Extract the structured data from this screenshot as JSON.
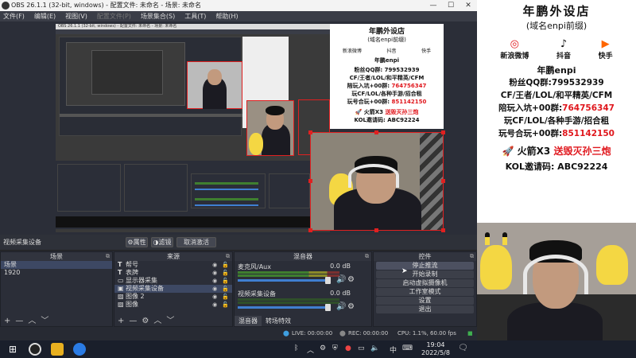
{
  "titlebar": {
    "title": "OBS 26.1.1 (32-bit, windows) - 配置文件: 未命名 - 场景: 未命名"
  },
  "menu": [
    "文件(F)",
    "编辑(E)",
    "视图(V)",
    "配置文件(P)",
    "场景集合(S)",
    "工具(T)",
    "帮助(H)"
  ],
  "nested_title": "OBS 26.1.1 (32-bit, windows) - 配置文件: 未命名 - 场景: 未命名",
  "poster_small": {
    "title": "年鹏外设店",
    "subtitle": "(域名enpi前缀)",
    "social": [
      "新浪微博",
      "抖音",
      "快手"
    ],
    "author": "年鹏enpi",
    "lines": [
      {
        "label": "粉丝QQ群:",
        "value": "799532939"
      },
      {
        "label": "CF/王者/LOL/和平精英/CFM",
        "value": ""
      },
      {
        "label": "陪玩入坑+00群:",
        "value": "764756347"
      },
      {
        "label": "玩CF/LOL/各种手游/招合租",
        "value": ""
      },
      {
        "label": "玩号合玩+00群:",
        "value": "851142150"
      }
    ],
    "rocket": "火箭X3",
    "rocket_red": "送毁灭孙三炮",
    "kol": "KOL邀请码: ABC92224"
  },
  "source_toolbar": {
    "label": "视频采集设备",
    "props": "属性",
    "filters": "滤镜",
    "deactivate": "取消激活"
  },
  "scenes": {
    "title": "场景",
    "items": [
      "场景",
      "1920"
    ]
  },
  "sources": {
    "title": "来源",
    "items": [
      {
        "icon": "T",
        "name": "帮号"
      },
      {
        "icon": "T",
        "name": "表牌"
      },
      {
        "icon": "▭",
        "name": "显示器采集"
      },
      {
        "icon": "▣",
        "name": "视频采集设备"
      },
      {
        "icon": "▨",
        "name": "图像 2"
      },
      {
        "icon": "▨",
        "name": "图像"
      }
    ]
  },
  "mixer": {
    "title": "混音器",
    "channels": [
      {
        "name": "麦克风/Aux",
        "db": "0.0 dB"
      },
      {
        "name": "视频采集设备",
        "db": "0.0 dB"
      }
    ],
    "tabs": [
      "混音器",
      "转场特效"
    ]
  },
  "controls": {
    "title": "控件",
    "buttons": [
      "停止推流",
      "开始录制",
      "启动虚拟摄像机",
      "工作室模式",
      "设置",
      "退出"
    ]
  },
  "status": {
    "live": "LIVE: 00:00:00",
    "rec": "REC: 00:00:00",
    "cpu": "CPU: 1.1%, 60.00 fps"
  },
  "right_panel": {
    "title": "年鹏外设店",
    "subtitle": "(域名enpi前缀)",
    "social": [
      "新浪微博",
      "抖音",
      "快手"
    ],
    "author": "年鹏enpi",
    "qq_label": "粉丝QQ群:",
    "qq_value": "799532939",
    "games": "CF/王者/LOL/和平精英/CFM",
    "peiwan_label": "陪玩入坑+00群:",
    "peiwan_value": "764756347",
    "zuhe": "玩CF/LOL/各种手游/招合租",
    "haohe_label": "玩号合玩+00群:",
    "haohe_value": "851142150",
    "rocket": "火箭X3",
    "rocket_red": "送毁灭孙三炮",
    "kol": "KOL邀请码: ABC92224"
  },
  "taskbar": {
    "time": "19:04",
    "date": "2022/5/8",
    "ime": "中"
  }
}
